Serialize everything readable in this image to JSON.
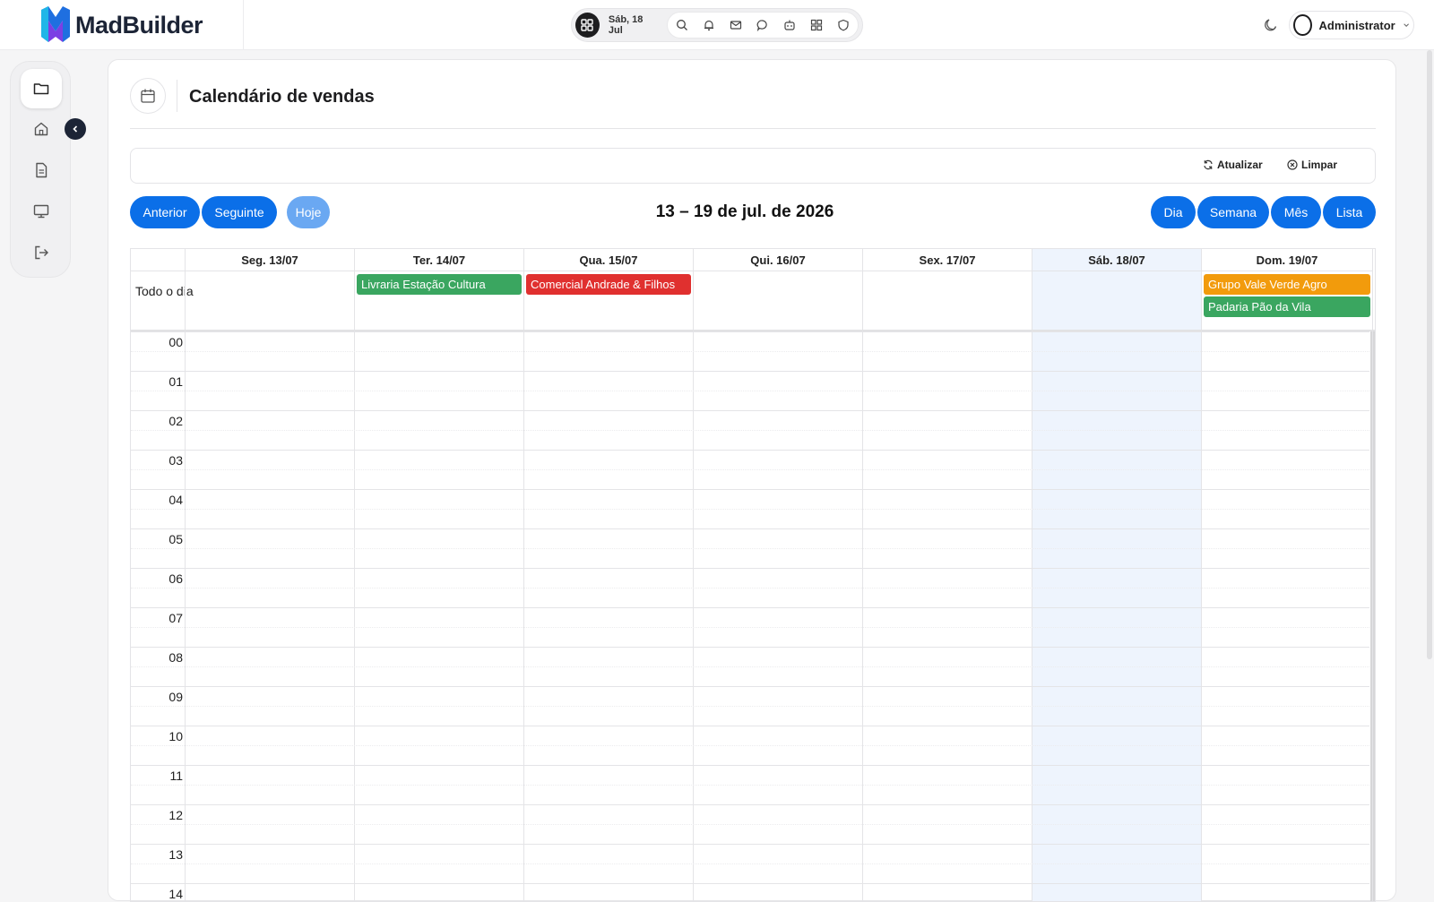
{
  "brand": {
    "name": "MadBuilder",
    "accent": "#0b6fe8"
  },
  "toolbar": {
    "date": "Sáb, 18 Jul",
    "icons": [
      "search-icon",
      "bell-icon",
      "mail-icon",
      "chat-icon",
      "robot-icon",
      "apps-icon",
      "shield-icon"
    ]
  },
  "user": {
    "name": "Administrator"
  },
  "sidebar": {
    "items": [
      "folder-icon",
      "home-icon",
      "document-icon",
      "monitor-icon",
      "logout-icon"
    ]
  },
  "page": {
    "title": "Calendário de vendas"
  },
  "filters": {
    "refresh_label": "Atualizar",
    "clear_label": "Limpar"
  },
  "nav": {
    "prev": "Anterior",
    "next": "Seguinte",
    "today": "Hoje"
  },
  "range_title": "13 – 19 de jul. de 2026",
  "views": {
    "day": "Dia",
    "week": "Semana",
    "month": "Mês",
    "list": "Lista"
  },
  "calendar": {
    "allday_label": "Todo o dia",
    "days": [
      "Seg. 13/07",
      "Ter. 14/07",
      "Qua. 15/07",
      "Qui. 16/07",
      "Sex. 17/07",
      "Sáb. 18/07",
      "Dom. 19/07"
    ],
    "today_index": 5,
    "hours": [
      "00",
      "01",
      "02",
      "03",
      "04",
      "05",
      "06",
      "07",
      "08",
      "09",
      "10",
      "11",
      "12",
      "13",
      "14"
    ],
    "events": [
      {
        "title": "Livraria Estação Cultura",
        "day": 1,
        "row": 0,
        "color": "#3aa660"
      },
      {
        "title": "Comercial Andrade & Filhos",
        "day": 2,
        "row": 0,
        "color": "#e0302f"
      },
      {
        "title": "Grupo Vale Verde Agro",
        "day": 6,
        "row": 0,
        "color": "#f29b0c"
      },
      {
        "title": "Padaria Pão da Vila",
        "day": 6,
        "row": 1,
        "color": "#3aa660"
      }
    ]
  }
}
